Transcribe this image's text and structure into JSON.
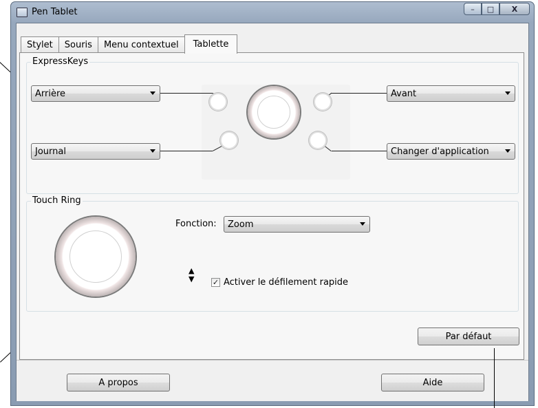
{
  "window": {
    "title": "Pen Tablet"
  },
  "titlebar_controls": {
    "minimize": "–",
    "maximize": "□",
    "close": "X"
  },
  "tabs": [
    {
      "label": "Stylet"
    },
    {
      "label": "Souris"
    },
    {
      "label": "Menu contextuel"
    },
    {
      "label": "Tablette",
      "active": true
    }
  ],
  "expresskeys": {
    "group_label": "ExpressKeys",
    "top_left": "Arrière",
    "bottom_left": "Journal",
    "top_right": "Avant",
    "bottom_right": "Changer d'application"
  },
  "touch_ring": {
    "group_label": "Touch Ring",
    "function_label": "Fonction:",
    "function_value": "Zoom",
    "fast_scroll_label": "Activer le défilement rapide",
    "fast_scroll_checked": true
  },
  "buttons": {
    "default": "Par défaut",
    "about": "A propos",
    "help": "Aide"
  }
}
